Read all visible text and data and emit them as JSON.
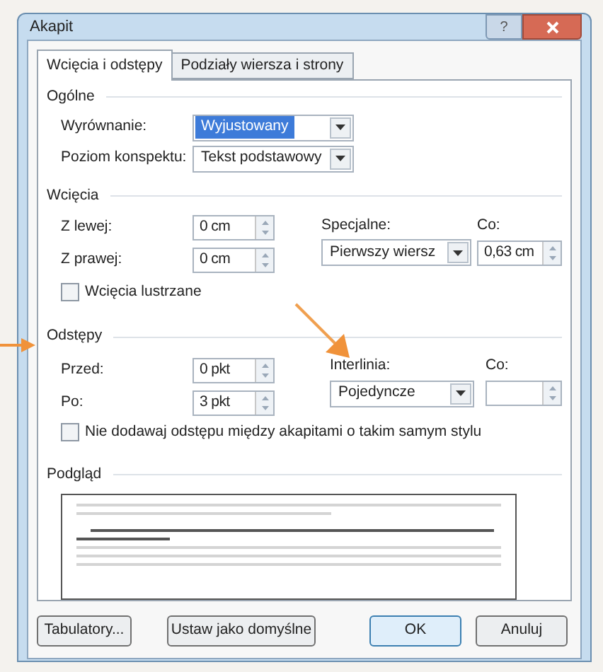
{
  "window": {
    "title": "Akapit",
    "help": "?"
  },
  "tabs": [
    {
      "label": "Wcięcia i odstępy",
      "selected": true
    },
    {
      "label": "Podziały wiersza i strony",
      "selected": false
    }
  ],
  "general": {
    "heading": "Ogólne",
    "fields": [
      {
        "label": "Wyrównanie:",
        "value": "Wyjustowany",
        "focused": true
      },
      {
        "label": "Poziom konspektu:",
        "value": "Tekst podstawowy",
        "focused": false
      }
    ]
  },
  "indentation": {
    "heading": "Wcięcia",
    "left": {
      "label": "Z lewej:",
      "value": "0 cm"
    },
    "right": {
      "label": "Z prawej:",
      "value": "0 cm"
    },
    "special": {
      "label": "Specjalne:",
      "value": "Pierwszy wiersz"
    },
    "by": {
      "label": "Co:",
      "value": "0,63 cm"
    },
    "mirror": {
      "label": "Wcięcia lustrzane",
      "checked": false
    }
  },
  "spacing": {
    "heading": "Odstępy",
    "before": {
      "label": "Przed:",
      "value": "0 pkt"
    },
    "after": {
      "label": "Po:",
      "value": "3 pkt"
    },
    "line_spacing": {
      "label": "Interlinia:",
      "value": "Pojedyncze"
    },
    "at": {
      "label": "Co:"
    },
    "no_space": {
      "label": "Nie dodawaj odstępu między akapitami o takim samym stylu",
      "checked": false
    }
  },
  "preview": {
    "heading": "Podgląd"
  },
  "buttons": [
    {
      "label": "Tabulatory...",
      "kind": "normal"
    },
    {
      "label": "Ustaw jako domyślne",
      "kind": "normal"
    },
    {
      "label": "OK",
      "kind": "default"
    },
    {
      "label": "Anuluj",
      "kind": "normal"
    }
  ]
}
